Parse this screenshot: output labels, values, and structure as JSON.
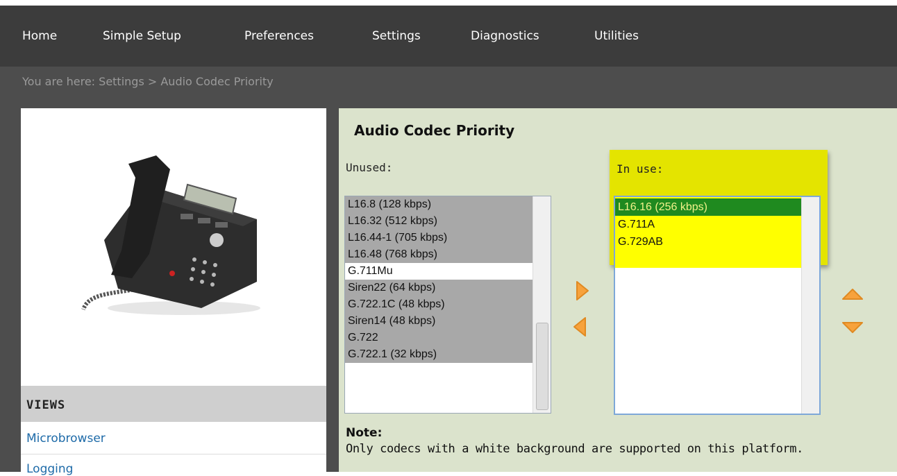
{
  "nav": {
    "items": [
      "Home",
      "Simple Setup",
      "Preferences",
      "Settings",
      "Diagnostics",
      "Utilities"
    ]
  },
  "breadcrumb": "You are here: Settings > Audio Codec Priority",
  "left": {
    "views_label": "VIEWS",
    "links": [
      "Microbrowser",
      "Logging"
    ]
  },
  "main": {
    "title": "Audio Codec Priority",
    "unused_label": "Unused:",
    "inuse_label": "In use:",
    "unused_items": [
      "L16.8 (128 kbps)",
      "L16.32 (512 kbps)",
      "L16.44-1 (705 kbps)",
      "L16.48 (768 kbps)",
      "G.711Mu",
      "Siren22 (64 kbps)",
      "G.722.1C (48 kbps)",
      "Siren14 (48 kbps)",
      "G.722",
      "G.722.1 (32 kbps)"
    ],
    "inuse_items": [
      "L16.16 (256 kbps)",
      "G.711A",
      "G.729AB"
    ],
    "note_title": "Note:",
    "note_text": "Only codecs with a white background are supported on this platform."
  },
  "colors": {
    "nav_bg": "#3c3c3c",
    "panel_bg": "#dbe3cc",
    "highlight": "#e4e400",
    "selected": "#1f8a1f",
    "arrow": "#f7a23c",
    "link": "#1d6aa8"
  }
}
